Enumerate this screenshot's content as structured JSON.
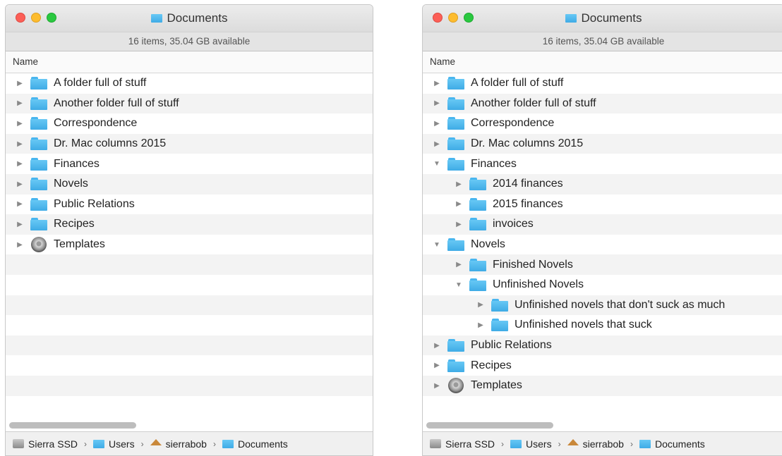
{
  "window_left": {
    "title": "Documents",
    "status": "16 items, 35.04 GB available",
    "column_header": "Name",
    "rows": [
      {
        "label": "A folder full of stuff",
        "icon": "folder-icon",
        "expanded": false,
        "level": 0
      },
      {
        "label": "Another folder full of stuff",
        "icon": "folder-icon",
        "expanded": false,
        "level": 0
      },
      {
        "label": "Correspondence",
        "icon": "folder-icon",
        "expanded": false,
        "level": 0
      },
      {
        "label": "Dr. Mac columns 2015",
        "icon": "folder-icon",
        "expanded": false,
        "level": 0
      },
      {
        "label": "Finances",
        "icon": "folder-icon",
        "expanded": false,
        "level": 0
      },
      {
        "label": "Novels",
        "icon": "folder-icon",
        "expanded": false,
        "level": 0
      },
      {
        "label": "Public Relations",
        "icon": "folder-icon",
        "expanded": false,
        "level": 0
      },
      {
        "label": "Recipes",
        "icon": "folder-icon",
        "expanded": false,
        "level": 0
      },
      {
        "label": "Templates",
        "icon": "disc-icon",
        "expanded": false,
        "level": 0
      }
    ],
    "path": [
      "Sierra SSD",
      "Users",
      "sierrabob",
      "Documents"
    ]
  },
  "window_right": {
    "title": "Documents",
    "status": "16 items, 35.04 GB available",
    "column_header": "Name",
    "rows": [
      {
        "label": "A folder full of stuff",
        "icon": "folder-icon",
        "expanded": false,
        "level": 0
      },
      {
        "label": "Another folder full of stuff",
        "icon": "folder-icon",
        "expanded": false,
        "level": 0
      },
      {
        "label": "Correspondence",
        "icon": "folder-icon",
        "expanded": false,
        "level": 0
      },
      {
        "label": "Dr. Mac columns 2015",
        "icon": "folder-icon",
        "expanded": false,
        "level": 0
      },
      {
        "label": "Finances",
        "icon": "folder-icon",
        "expanded": true,
        "level": 0
      },
      {
        "label": "2014 finances",
        "icon": "folder-icon",
        "expanded": false,
        "level": 1
      },
      {
        "label": "2015 finances",
        "icon": "folder-icon",
        "expanded": false,
        "level": 1
      },
      {
        "label": "invoices",
        "icon": "folder-icon",
        "expanded": false,
        "level": 1
      },
      {
        "label": "Novels",
        "icon": "folder-icon",
        "expanded": true,
        "level": 0
      },
      {
        "label": "Finished Novels",
        "icon": "folder-icon",
        "expanded": false,
        "level": 1
      },
      {
        "label": "Unfinished Novels",
        "icon": "folder-icon",
        "expanded": true,
        "level": 1
      },
      {
        "label": "Unfinished novels that don't suck as much",
        "icon": "folder-icon",
        "expanded": false,
        "level": 2
      },
      {
        "label": "Unfinished novels that suck",
        "icon": "folder-icon",
        "expanded": false,
        "level": 2
      },
      {
        "label": "Public Relations",
        "icon": "folder-icon",
        "expanded": false,
        "level": 0
      },
      {
        "label": "Recipes",
        "icon": "folder-icon",
        "expanded": false,
        "level": 0
      },
      {
        "label": "Templates",
        "icon": "disc-icon",
        "expanded": false,
        "level": 0
      }
    ],
    "path": [
      "Sierra SSD",
      "Users",
      "sierrabob",
      "Documents"
    ]
  }
}
